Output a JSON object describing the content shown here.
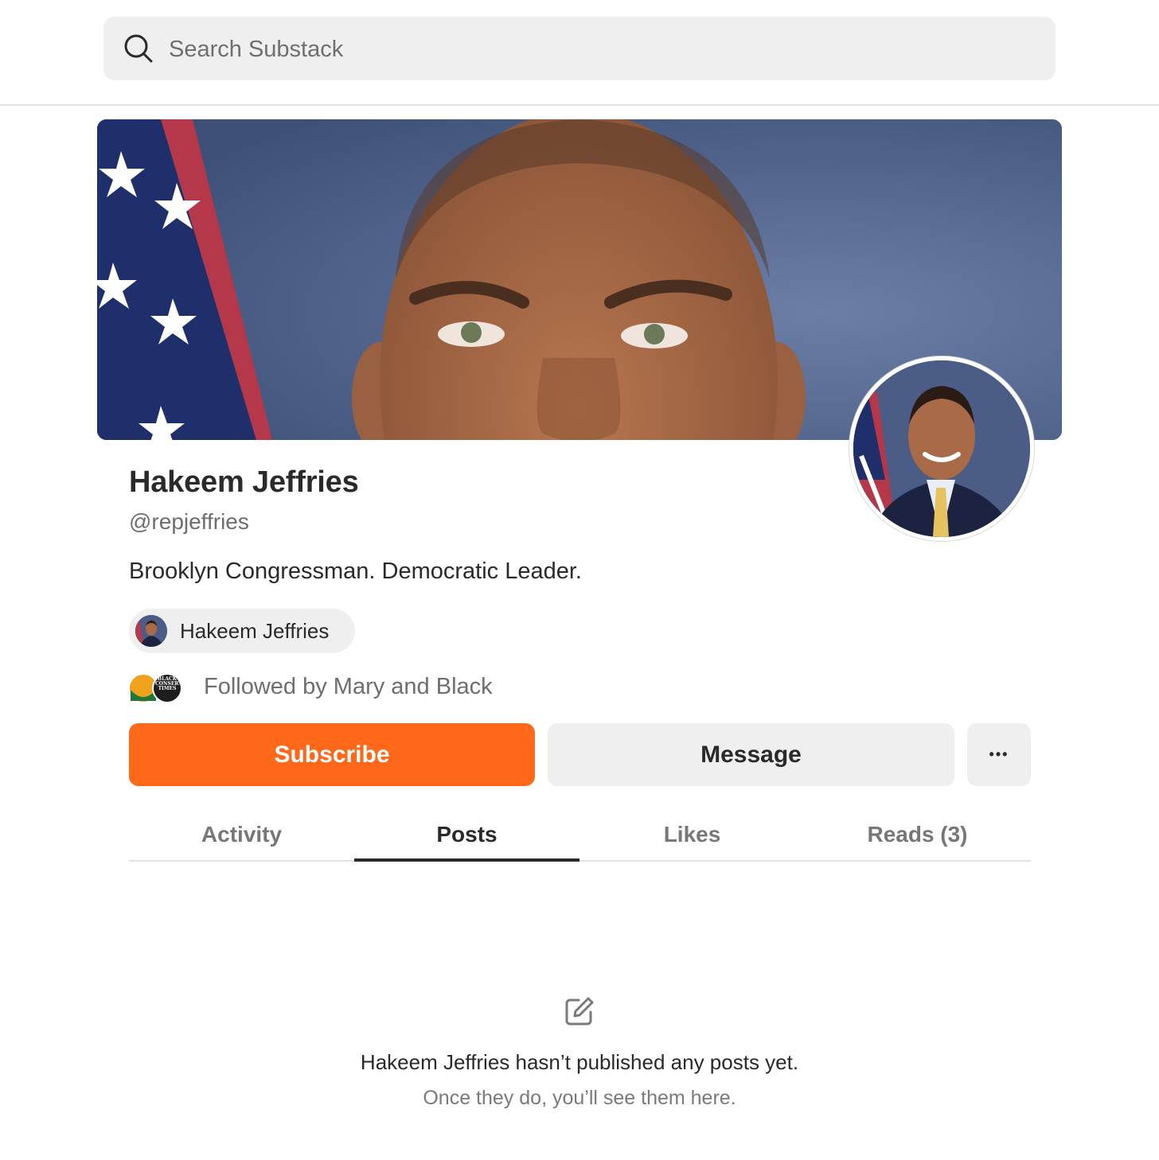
{
  "search": {
    "placeholder": "Search Substack"
  },
  "profile": {
    "name": "Hakeem Jeffries",
    "handle": "@repjeffries",
    "bio": "Brooklyn Congressman. Democratic Leader.",
    "publication": "Hakeem Jeffries",
    "followed_by": "Followed by Mary and Black",
    "follower_badge_text": "BLACK CONSERVATIVE TIMES"
  },
  "actions": {
    "subscribe": "Subscribe",
    "message": "Message",
    "more": "•••"
  },
  "tabs": [
    {
      "label": "Activity",
      "active": false
    },
    {
      "label": "Posts",
      "active": true
    },
    {
      "label": "Likes",
      "active": false
    },
    {
      "label": "Reads (3)",
      "active": false
    }
  ],
  "empty_state": {
    "icon": "edit-icon",
    "title": "Hakeem Jeffries hasn’t published any posts yet.",
    "subtitle": "Once they do, you’ll see them here."
  },
  "colors": {
    "accent": "#ff6719",
    "chip_bg": "#efefef",
    "cover_bg": "#4a5e86"
  }
}
